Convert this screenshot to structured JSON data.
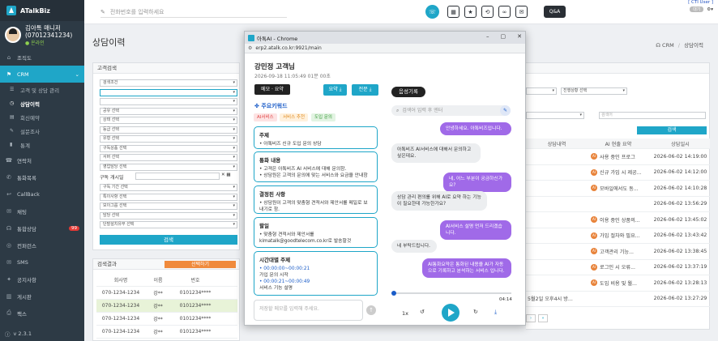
{
  "app": {
    "name": "ATalkBiz",
    "version": "v 2.3.1"
  },
  "profile": {
    "name": "김아톡 매니저",
    "phone": "(07012341234)",
    "status": "온라인"
  },
  "sidebar": {
    "items": [
      {
        "label": "조직도",
        "icon": "org-icon"
      },
      {
        "label": "CRM",
        "icon": "crm-icon",
        "active": true
      },
      {
        "label": "고객 및 상담 관리",
        "sub": true,
        "icon": "users-icon"
      },
      {
        "label": "상담이력",
        "sub": true,
        "active": true,
        "icon": "history-icon"
      },
      {
        "label": "회신예약",
        "sub": true,
        "icon": "calendar-icon"
      },
      {
        "label": "설문조사",
        "sub": true,
        "icon": "survey-icon"
      },
      {
        "label": "통계",
        "sub": true,
        "icon": "chart-icon"
      },
      {
        "label": "연락처",
        "icon": "contact-icon"
      },
      {
        "label": "통화목록",
        "icon": "phone-icon"
      },
      {
        "label": "CallBack",
        "icon": "callback-icon"
      },
      {
        "label": "채팅",
        "icon": "chat-icon"
      },
      {
        "label": "통합상담",
        "icon": "headset-icon",
        "badge": "99"
      },
      {
        "label": "컨퍼런스",
        "icon": "conference-icon"
      },
      {
        "label": "SMS",
        "icon": "sms-icon"
      },
      {
        "label": "공지사항",
        "icon": "notice-icon"
      },
      {
        "label": "게시판",
        "icon": "board-icon"
      },
      {
        "label": "팩스",
        "icon": "fax-icon"
      }
    ]
  },
  "topbar": {
    "phone_placeholder": "전화번호를 입력하세요",
    "qa_label": "Q&A",
    "cti_label": "[ CTI User ]",
    "status_pill": "대기"
  },
  "page": {
    "title": "상담이력",
    "breadcrumb": [
      "CRM",
      "상담이력"
    ]
  },
  "search_panel": {
    "title": "고객검색",
    "rows": [
      "검색조건",
      "",
      "",
      "공유 선택",
      "상태 선택",
      "등급 선택",
      "유형 선택",
      "구독상품 선택",
      "서버 선택",
      "영업담당 선택"
    ],
    "subscribe_label": "구독 개시일",
    "rows2": [
      "구독 기간 선택",
      "특이사항 선택",
      "모이그룹 선택",
      "담당 선택",
      "단말설치유무 선택"
    ],
    "search_button": "검색"
  },
  "results": {
    "title": "검색결과",
    "select_button": "선택하기",
    "headers": [
      "회사명",
      "이름",
      "번호"
    ],
    "rows": [
      [
        "070-1234-1234",
        "강**",
        "0101234****"
      ],
      [
        "070-1234-1234",
        "강**",
        "0101234****"
      ],
      [
        "070-1234-1234",
        "강**",
        "0101234****"
      ],
      [
        "070-1234-1234",
        "강**",
        "0101234****"
      ],
      [
        "070-1234-1234",
        "강**",
        "0101234****"
      ]
    ]
  },
  "list": {
    "status_select": "진행상황 선택",
    "search_placeholder": "검색어",
    "search_button": "검색",
    "headers": [
      "상담내역",
      "AI 현출 요약",
      "상담일시"
    ],
    "rows": [
      {
        "a": "",
        "b": "사용 중인 프로그",
        "c": "2026-06-02 14:19:00",
        "ai": true
      },
      {
        "a": "",
        "b": "신규 가입 시 제공...",
        "c": "2026-06-02 14:12:00",
        "ai": true
      },
      {
        "a": "",
        "b": "모바일에서도 동...",
        "c": "2026-06-02 14:10:28",
        "ai": true
      },
      {
        "a": "",
        "b": "",
        "c": "2026-06-02 13:56:29",
        "ai": false
      },
      {
        "a": "",
        "b": "이용 중인 상품의...",
        "c": "2026-06-02 13:45:02",
        "ai": true
      },
      {
        "a": "",
        "b": "가입 절차와 필요...",
        "c": "2026-06-02 13:43:42",
        "ai": true
      },
      {
        "a": "",
        "b": "고객관리 기능...",
        "c": "2026-06-02 13:38:45",
        "ai": true
      },
      {
        "a": "",
        "b": "로그인 시 오류...",
        "c": "2026-06-02 13:37:19",
        "ai": true
      },
      {
        "a": "",
        "b": "도입 비용 및 월...",
        "c": "2026-06-02 13:28:13",
        "ai": true
      },
      {
        "a": "5월2일 오후4시 방...",
        "b": "",
        "c": "2026-06-02 13:27:29",
        "ai": false
      }
    ],
    "ai_badge": "AI"
  },
  "popup": {
    "window_title": "아톡AI - Chrome",
    "url": "erp2.atalk.co.kr:9921/main",
    "customer": "강민정 고객님",
    "datetime": "2026-09-18 11:05:49 01분 00초",
    "memo_tab": "메모 · 요약",
    "save_btn": "요약",
    "full_btn": "전문",
    "keywords_title": "주요키워드",
    "keywords": [
      "AI서비스",
      "서비스 추천",
      "도입 문의"
    ],
    "summary": [
      {
        "title": "주제",
        "lines": [
          "• 아톡비즈 신규 도입 문의 상담"
        ]
      },
      {
        "title": "통화 내용",
        "lines": [
          "• 고객은 아톡비즈 AI 서비스에 대해 문의함.",
          "• 상담원은 고객의 문의에 맞는 서비스와 요금을 안내함"
        ]
      },
      {
        "title": "결정된 사항",
        "lines": [
          "• 상담원이 고객의 맞춤형 견적서와 제안서를 메일로 보",
          "  내기로 함."
        ]
      },
      {
        "title": "할일",
        "lines": [
          "• 맞춤형 견적서와 제안서를",
          "kimatalk@goodtelecom.co.kr로 발송할것"
        ]
      },
      {
        "title": "시간대별 주제",
        "lines": [
          "• 00:00:00~00:00:21",
          "  가입 문의 시작",
          "• 00:00:21~00:00:49",
          "  서비스 기능 설명"
        ]
      }
    ],
    "memo_placeholder": "저장할 메모를 입력해 주세요.",
    "voice_tab": "음성기록",
    "chat_search_placeholder": "검색어 입력 후 엔터",
    "chat": [
      {
        "side": "right",
        "text": "안녕하세요. 아톡비즈입니다."
      },
      {
        "side": "left",
        "text": "아톡비즈 AI서비스에 대해서 문의하고 싶은데요."
      },
      {
        "side": "right",
        "text": "네, 어느 부분이 궁금하신가요?"
      },
      {
        "side": "left",
        "text": "상담 관리 편의를 위해 AI로 요약 하는 기능이 필요한데 가능한가요?"
      },
      {
        "side": "right",
        "text": "AI서비스 설명 먼저 드리겠습니다."
      },
      {
        "side": "left",
        "text": "네 부탁드립니다."
      },
      {
        "side": "right",
        "text": "AI통화요약은 통화된 내용을 AI가 자동으로 기록하고 분석하는 서비스 입니다."
      }
    ],
    "duration": "04:14",
    "speed": "1x"
  }
}
